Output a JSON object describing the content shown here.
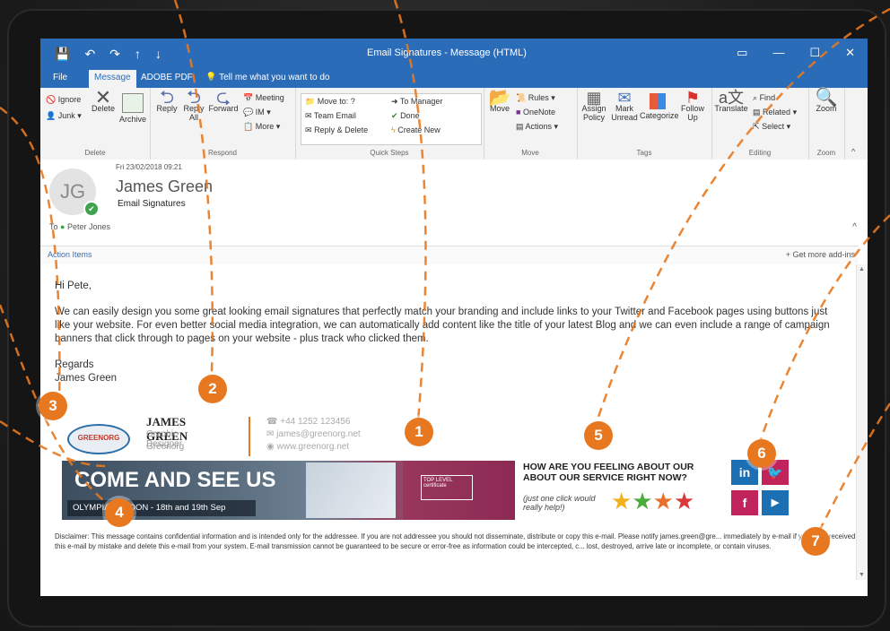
{
  "window": {
    "title": "Email Signatures - Message (HTML)"
  },
  "tabs": [
    {
      "label": "File"
    },
    {
      "label": "Message"
    },
    {
      "label": "ADOBE PDF"
    },
    {
      "label": "Tell me what you want to do"
    }
  ],
  "ribbon": {
    "delete_group": {
      "label": "Delete",
      "ignore": "Ignore",
      "junk": "Junk",
      "delete": "Delete",
      "archive": "Archive"
    },
    "respond_group": {
      "label": "Respond",
      "reply": "Reply",
      "reply_all": "Reply All",
      "forward": "Forward",
      "meeting": "Meeting",
      "im": "IM",
      "more": "More"
    },
    "quicksteps_group": {
      "label": "Quick Steps",
      "items": [
        "Move to: ?",
        "Team Email",
        "Reply & Delete",
        "To Manager",
        "Done",
        "Create New"
      ]
    },
    "move_group": {
      "label": "Move",
      "move": "Move",
      "rules": "Rules",
      "onenote": "OneNote",
      "actions": "Actions"
    },
    "tags_group": {
      "label": "Tags",
      "assign_policy": "Assign Policy",
      "mark_unread": "Mark Unread",
      "categorize": "Categorize",
      "follow_up": "Follow Up"
    },
    "editing_group": {
      "label": "Editing",
      "translate": "Translate",
      "find": "Find",
      "related": "Related",
      "select": "Select"
    },
    "zoom_group": {
      "label": "Zoom",
      "zoom": "Zoom"
    }
  },
  "message": {
    "date": "Fri 23/02/2018 09:21",
    "avatar_initials": "JG",
    "sender": "James Green",
    "subject": "Email Signatures",
    "to_label": "To",
    "recipient": "Peter Jones",
    "action_items": "Action Items",
    "get_addins": "+ Get more add-ins",
    "greeting": "Hi Pete,",
    "paragraph": "We can easily design you some great looking email signatures that perfectly match your branding and include links to your Twitter and Facebook pages using buttons just like your website. For even better social media integration, we can automatically add content like the title of your latest Blog and we can even include a range of campaign banners that click through to pages on your website - plus track who clicked them.",
    "regards": "Regards",
    "signoff": "James Green"
  },
  "signature": {
    "logo_text": "GREENORG",
    "name": "JAMES GREEN",
    "title": "Graphic Designer",
    "company": "Greenorg",
    "phone": "+44 1252 123456",
    "email": "james@greenorg.net",
    "web": "www.greenorg.net"
  },
  "banner": {
    "headline": "COME AND SEE US",
    "subline": "OLYMPIA LONDON - 18th and 19th Sep",
    "tag": "TOP LEVEL certificate"
  },
  "survey": {
    "question": "HOW ARE YOU FEELING ABOUT OUR ABOUT OUR SERVICE RIGHT NOW?",
    "hint": "(just one click would really help!)",
    "stars": [
      "#f3b11f",
      "#4daa3f",
      "#e9702a",
      "#d83a3a"
    ]
  },
  "social": {
    "linkedin": "in",
    "twitter": "🐦",
    "facebook": "f",
    "youtube": "▶"
  },
  "disclaimer": "Disclaimer: This message contains confidential information and is intended only for the addressee. If you are not addressee you should not disseminate, distribute or copy this e-mail. Please notify james.green@gre... immediately by e-mail if you have received this e-mail by mistake and delete this e-mail from your system. E-mail transmission cannot be guaranteed to be secure or error-free as information could be intercepted, c... lost, destroyed, arrive late or incomplete, or contain viruses.",
  "callouts": [
    "1",
    "2",
    "3",
    "4",
    "5",
    "6",
    "7"
  ],
  "colors": {
    "accent": "#2b6cb8",
    "badge": "#e8781f"
  }
}
